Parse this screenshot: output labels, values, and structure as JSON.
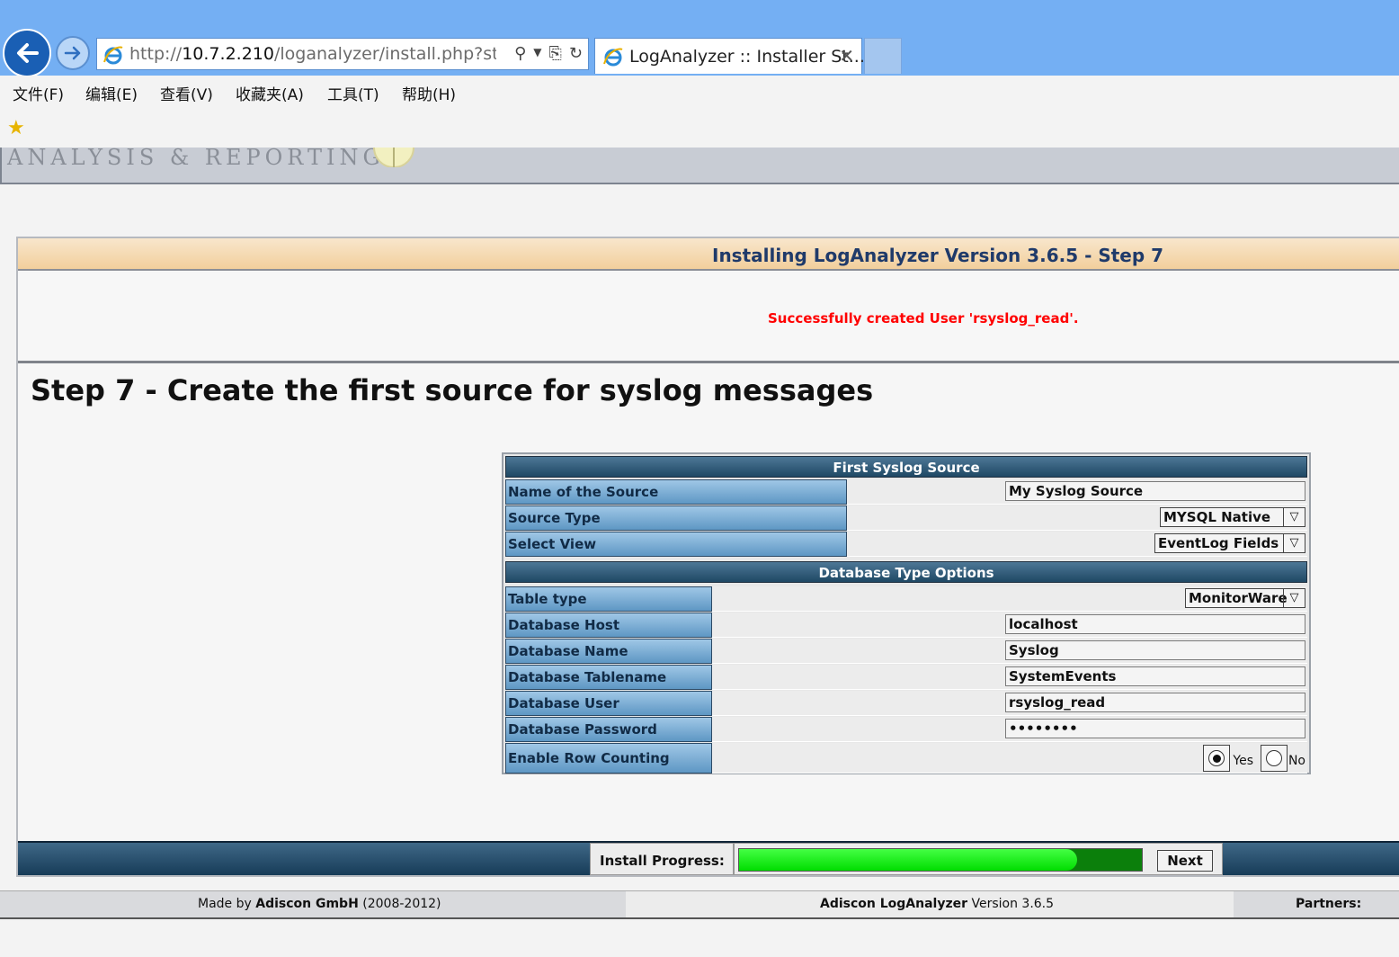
{
  "browser": {
    "url_prefix": "http://",
    "url_host": "10.7.2.210",
    "url_path": "/loganalyzer/install.php?step=",
    "tab_title": "LogAnalyzer :: Installer St...",
    "menu": [
      "文件(F)",
      "编辑(E)",
      "查看(V)",
      "收藏夹(A)",
      "工具(T)",
      "帮助(H)"
    ]
  },
  "header": {
    "tagline": "ANALYSIS & REPORTING"
  },
  "installer": {
    "title": "Installing LogAnalyzer Version 3.6.5 - Step 7",
    "success_message": "Successfully created User 'rsyslog_read'.",
    "step_heading": "Step 7 - Create the first source for syslog messages"
  },
  "form": {
    "section1_title": "First Syslog Source",
    "section2_title": "Database Type Options",
    "source_name_label": "Name of the Source",
    "source_name_value": "My Syslog Source",
    "source_type_label": "Source Type",
    "source_type_value": "MYSQL Native",
    "select_view_label": "Select View",
    "select_view_value": "EventLog Fields",
    "table_type_label": "Table type",
    "table_type_value": "MonitorWare",
    "db_host_label": "Database Host",
    "db_host_value": "localhost",
    "db_name_label": "Database Name",
    "db_name_value": "Syslog",
    "db_table_label": "Database Tablename",
    "db_table_value": "SystemEvents",
    "db_user_label": "Database User",
    "db_user_value": "rsyslog_read",
    "db_pass_label": "Database Password",
    "db_pass_value": "••••••••",
    "row_count_label": "Enable Row Counting",
    "yes_label": "Yes",
    "no_label": "No",
    "row_count_selected": "Yes"
  },
  "progress": {
    "label": "Install Progress:",
    "fraction": 0.84,
    "next_label": "Next"
  },
  "footer": {
    "made_by_prefix": "Made by ",
    "company": "Adiscon GmbH",
    "years": " (2008-2012)",
    "product": "Adiscon LogAnalyzer",
    "version": " Version 3.6.5",
    "partners": "Partners:"
  },
  "colors": {
    "success": "#ff0000",
    "progress_fill": "#00dd00",
    "section_header": "#1f4864"
  },
  "icons": [
    "back-arrow-icon",
    "forward-arrow-icon",
    "ie-logo-icon",
    "search-icon",
    "dropdown-icon",
    "compat-view-icon",
    "refresh-icon",
    "close-icon",
    "favorites-star-icon"
  ]
}
